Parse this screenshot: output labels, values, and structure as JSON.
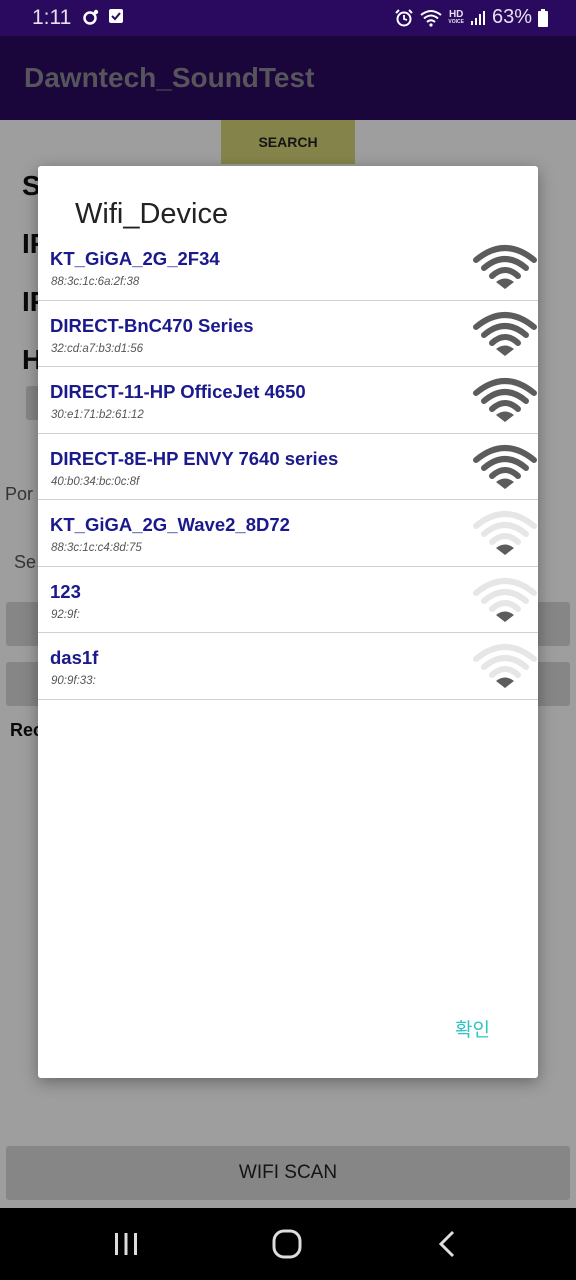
{
  "status_bar": {
    "time": "1:11",
    "battery": "63%",
    "hd_label_top": "HD",
    "hd_label_bottom": "VOICE"
  },
  "app_bar": {
    "title": "Dawntech_SoundTest"
  },
  "background": {
    "search_label": "SEARCH",
    "letters": [
      "S",
      "IF",
      "IF",
      "H"
    ],
    "port_label": "Por",
    "se_label": "Se",
    "rec_label": "Rec",
    "wifi_scan_label": "WIFI SCAN"
  },
  "dialog": {
    "title": "Wifi_Device",
    "confirm_label": "확인",
    "devices": [
      {
        "name": "KT_GiGA_2G_2F34",
        "mac": "88:3c:1c:6a:2f:38",
        "signal": "strong"
      },
      {
        "name": "DIRECT-BnC470 Series",
        "mac": "32:cd:a7:b3:d1:56",
        "signal": "strong"
      },
      {
        "name": "DIRECT-11-HP OfficeJet 4650",
        "mac": "30:e1:71:b2:61:12",
        "signal": "strong"
      },
      {
        "name": "DIRECT-8E-HP ENVY 7640 series",
        "mac": "40:b0:34:bc:0c:8f",
        "signal": "strong"
      },
      {
        "name": "KT_GiGA_2G_Wave2_8D72",
        "mac": "88:3c:1c:c4:8d:75",
        "signal": "weak"
      },
      {
        "name": "123",
        "mac": "92:9f:",
        "signal": "weak"
      },
      {
        "name": "das1f",
        "mac": "90:9f:33:",
        "signal": "weak"
      }
    ]
  },
  "icons": {
    "wifi_strong": "wifi-full-icon",
    "wifi_weak": "wifi-weak-icon",
    "recent_apps": "recent-apps-icon",
    "home": "home-icon",
    "back": "back-icon"
  },
  "colors": {
    "app_bar": "#2a0a5e",
    "device_name": "#1a1a8c",
    "confirm": "#2fc3c3",
    "search_button": "#d6d678"
  }
}
